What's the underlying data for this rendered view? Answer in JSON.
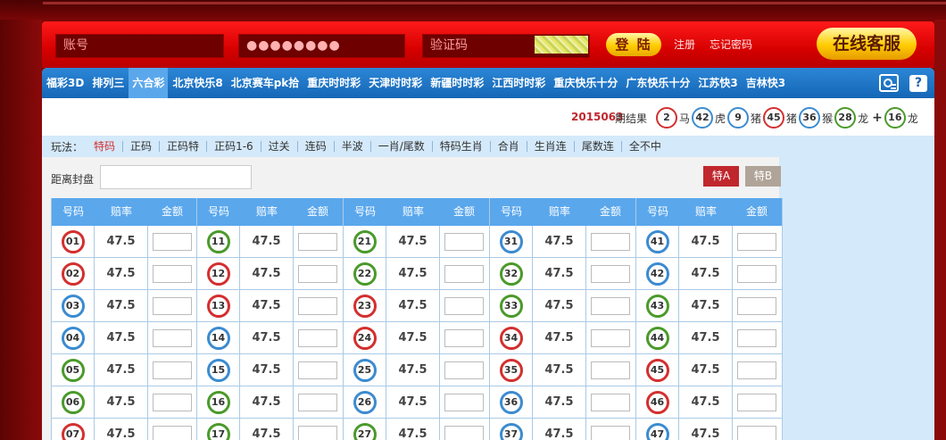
{
  "login": {
    "account_placeholder": "账号",
    "password_value": "●●●●●●●●",
    "captcha_placeholder": "验证码",
    "login_button": "登 陆",
    "register_link": "注册",
    "forgot_link": "忘记密码",
    "service_button": "在线客服"
  },
  "nav": {
    "games": [
      {
        "label": "福彩3D",
        "active": false
      },
      {
        "label": "排列三",
        "active": false
      },
      {
        "label": "六合彩",
        "active": true
      },
      {
        "label": "北京快乐8",
        "active": false
      },
      {
        "label": "北京赛车pk拾",
        "active": false
      },
      {
        "label": "重庆时时彩",
        "active": false
      },
      {
        "label": "天津时时彩",
        "active": false
      },
      {
        "label": "新疆时时彩",
        "active": false
      },
      {
        "label": "江西时时彩",
        "active": false
      },
      {
        "label": "重庆快乐十分",
        "active": false
      },
      {
        "label": "广东快乐十分",
        "active": false
      },
      {
        "label": "江苏快3",
        "active": false
      },
      {
        "label": "吉林快3",
        "active": false
      }
    ],
    "help_icon_label": "?"
  },
  "result": {
    "period": "2015063",
    "suffix": "期结果",
    "balls": [
      {
        "num": "2",
        "zodiac": "马",
        "color": "red"
      },
      {
        "num": "42",
        "zodiac": "虎",
        "color": "blue"
      },
      {
        "num": "9",
        "zodiac": "猪",
        "color": "blue"
      },
      {
        "num": "45",
        "zodiac": "猪",
        "color": "red"
      },
      {
        "num": "36",
        "zodiac": "猴",
        "color": "blue"
      },
      {
        "num": "28",
        "zodiac": "龙",
        "color": "green"
      }
    ],
    "plus": "+",
    "special": {
      "num": "16",
      "zodiac": "龙",
      "color": "green"
    }
  },
  "play": {
    "label": "玩法：",
    "items": [
      {
        "label": "特码",
        "active": true
      },
      {
        "label": "正码",
        "active": false
      },
      {
        "label": "正码特",
        "active": false
      },
      {
        "label": "正码1-6",
        "active": false
      },
      {
        "label": "过关",
        "active": false
      },
      {
        "label": "连码",
        "active": false
      },
      {
        "label": "半波",
        "active": false
      },
      {
        "label": "一肖/尾数",
        "active": false
      },
      {
        "label": "特码生肖",
        "active": false
      },
      {
        "label": "合肖",
        "active": false
      },
      {
        "label": "生肖连",
        "active": false
      },
      {
        "label": "尾数连",
        "active": false
      },
      {
        "label": "全不中",
        "active": false
      }
    ]
  },
  "betting": {
    "close_label": "距离封盘",
    "close_value": "",
    "btn_a": "特A",
    "btn_b": "特B",
    "headers": {
      "number": "号码",
      "odds": "赔率",
      "amount": "金额"
    },
    "groups": [
      [
        {
          "num": "01",
          "color": "red",
          "odds": "47.5"
        },
        {
          "num": "02",
          "color": "red",
          "odds": "47.5"
        },
        {
          "num": "03",
          "color": "blue",
          "odds": "47.5"
        },
        {
          "num": "04",
          "color": "blue",
          "odds": "47.5"
        },
        {
          "num": "05",
          "color": "green",
          "odds": "47.5"
        },
        {
          "num": "06",
          "color": "green",
          "odds": "47.5"
        },
        {
          "num": "07",
          "color": "red",
          "odds": "47.5"
        }
      ],
      [
        {
          "num": "11",
          "color": "green",
          "odds": "47.5"
        },
        {
          "num": "12",
          "color": "red",
          "odds": "47.5"
        },
        {
          "num": "13",
          "color": "red",
          "odds": "47.5"
        },
        {
          "num": "14",
          "color": "blue",
          "odds": "47.5"
        },
        {
          "num": "15",
          "color": "blue",
          "odds": "47.5"
        },
        {
          "num": "16",
          "color": "green",
          "odds": "47.5"
        },
        {
          "num": "17",
          "color": "green",
          "odds": "47.5"
        }
      ],
      [
        {
          "num": "21",
          "color": "green",
          "odds": "47.5"
        },
        {
          "num": "22",
          "color": "green",
          "odds": "47.5"
        },
        {
          "num": "23",
          "color": "red",
          "odds": "47.5"
        },
        {
          "num": "24",
          "color": "red",
          "odds": "47.5"
        },
        {
          "num": "25",
          "color": "blue",
          "odds": "47.5"
        },
        {
          "num": "26",
          "color": "blue",
          "odds": "47.5"
        },
        {
          "num": "27",
          "color": "green",
          "odds": "47.5"
        }
      ],
      [
        {
          "num": "31",
          "color": "blue",
          "odds": "47.5"
        },
        {
          "num": "32",
          "color": "green",
          "odds": "47.5"
        },
        {
          "num": "33",
          "color": "green",
          "odds": "47.5"
        },
        {
          "num": "34",
          "color": "red",
          "odds": "47.5"
        },
        {
          "num": "35",
          "color": "red",
          "odds": "47.5"
        },
        {
          "num": "36",
          "color": "blue",
          "odds": "47.5"
        },
        {
          "num": "37",
          "color": "blue",
          "odds": "47.5"
        }
      ],
      [
        {
          "num": "41",
          "color": "blue",
          "odds": "47.5"
        },
        {
          "num": "42",
          "color": "blue",
          "odds": "47.5"
        },
        {
          "num": "43",
          "color": "green",
          "odds": "47.5"
        },
        {
          "num": "44",
          "color": "green",
          "odds": "47.5"
        },
        {
          "num": "45",
          "color": "red",
          "odds": "47.5"
        },
        {
          "num": "46",
          "color": "red",
          "odds": "47.5"
        },
        {
          "num": "47",
          "color": "blue",
          "odds": "47.5"
        }
      ]
    ]
  },
  "colors": {
    "brand_red": "#d60000",
    "nav_blue": "#1567b6",
    "ball_red": "#d32f2f",
    "ball_blue": "#3b8bd0",
    "ball_green": "#4a9a2a",
    "gold": "#ffcc00"
  }
}
